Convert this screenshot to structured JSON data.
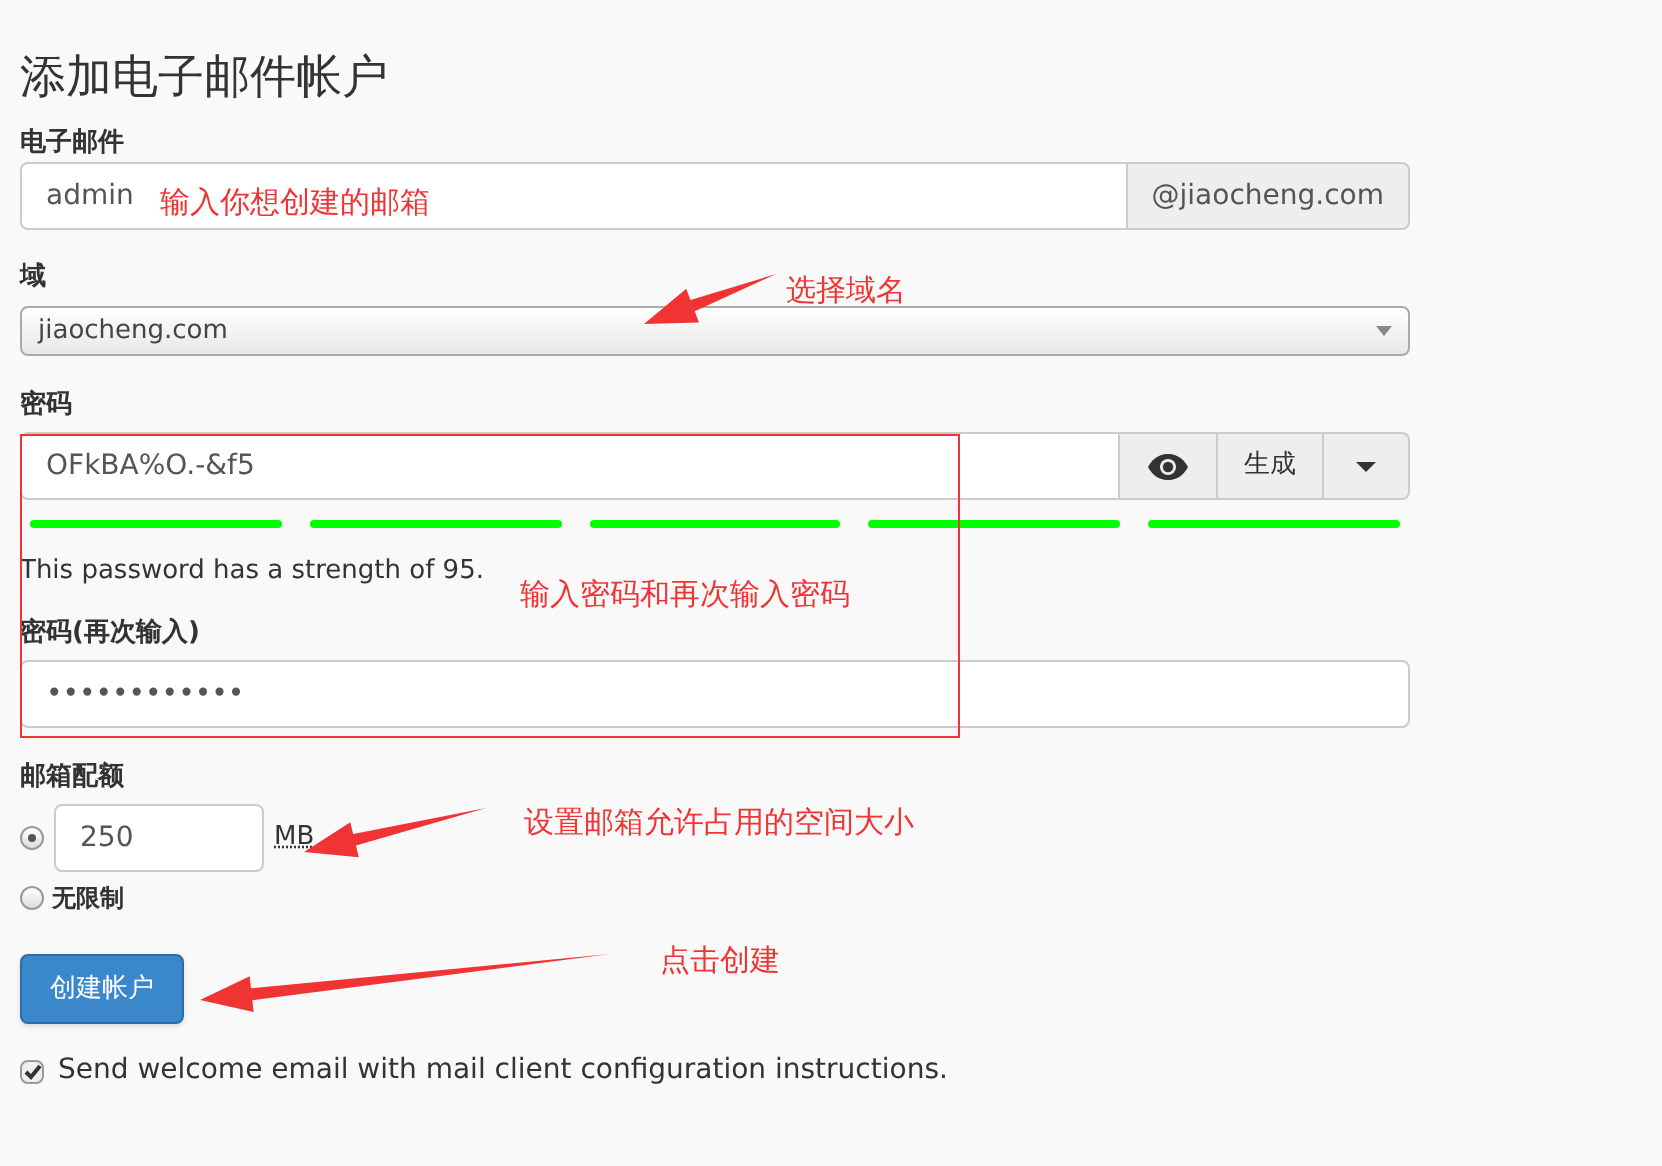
{
  "title": "添加电子邮件帐户",
  "email": {
    "label": "电子邮件",
    "value": "admin",
    "suffix": "@jiaocheng.com"
  },
  "domain": {
    "label": "域",
    "value": "jiaocheng.com"
  },
  "password": {
    "label": "密码",
    "value": "OFkBA%O.-&f5",
    "generate": "生成",
    "meter": [
      {
        "on": true
      },
      {
        "on": true
      },
      {
        "on": true
      },
      {
        "on": true
      },
      {
        "on": true
      }
    ],
    "strength_text": "This password has a strength of 95."
  },
  "password_again": {
    "label": "密码(再次输入)",
    "value": "••••••••••••"
  },
  "quota": {
    "label": "邮箱配额",
    "options": [
      {
        "kind": "amount",
        "selected": true,
        "value": "250",
        "unit": "MB"
      },
      {
        "kind": "unlimited",
        "selected": false,
        "label": "无限制"
      }
    ]
  },
  "submit": "创建帐户",
  "welcome": {
    "checked": true,
    "label": "Send welcome email with mail client configuration instructions."
  },
  "annotations": [
    "输入你想创建的邮箱",
    "选择域名",
    "输入密码和再次输入密码",
    "设置邮箱允许占用的空间大小",
    "点击创建"
  ]
}
